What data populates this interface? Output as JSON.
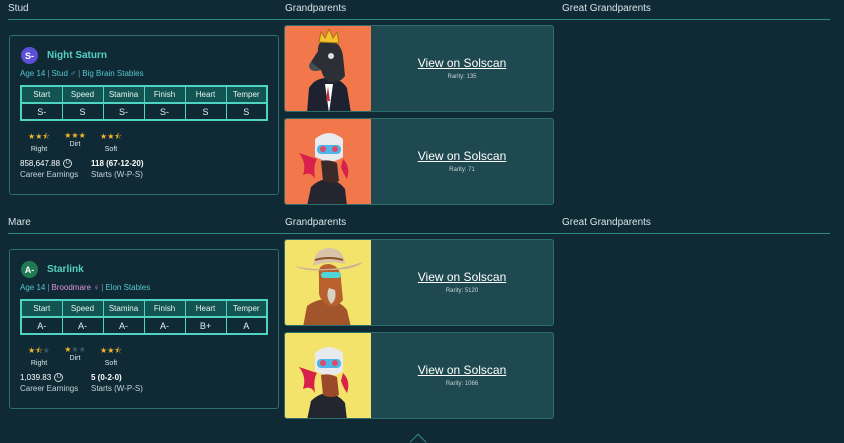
{
  "sections": {
    "stud": "Stud",
    "mare": "Mare",
    "grandparents": "Grandparents",
    "great_grandparents": "Great Grandparents"
  },
  "stud": {
    "name": "Night Saturn",
    "grade": "S-",
    "grade_color": "#5b4fd6",
    "age": "Age 14",
    "role": "Stud",
    "role_icon": "male-icon",
    "stable": "Big Brain Stables",
    "stats_headers": [
      "Start",
      "Speed",
      "Stamina",
      "Finish",
      "Heart",
      "Temper"
    ],
    "stats_values": [
      "S-",
      "S",
      "S-",
      "S-",
      "S",
      "S"
    ],
    "prefs": [
      {
        "label": "Right",
        "stars": 2.5
      },
      {
        "label": "Dirt",
        "stars": 3
      },
      {
        "label": "Soft",
        "stars": 2.5
      }
    ],
    "earnings": "858,647.88",
    "earnings_label": "Career Earnings",
    "starts": "118 (67-12-20)",
    "starts_label": "Starts (W-P-S)"
  },
  "mare": {
    "name": "Starlink",
    "grade": "A-",
    "grade_color": "#1f7a52",
    "age": "Age 14",
    "role": "Broodmare",
    "role_icon": "female-icon",
    "stable": "Elon Stables",
    "stats_headers": [
      "Start",
      "Speed",
      "Stamina",
      "Finish",
      "Heart",
      "Temper"
    ],
    "stats_values": [
      "A-",
      "A-",
      "A-",
      "A-",
      "B+",
      "A"
    ],
    "prefs": [
      {
        "label": "Right",
        "stars": 1.5
      },
      {
        "label": "Dirt",
        "stars": 1
      },
      {
        "label": "Soft",
        "stars": 2.5
      }
    ],
    "earnings": "1,039.83",
    "earnings_label": "Career Earnings",
    "starts": "5 (0-2-0)",
    "starts_label": "Starts (W-P-S)"
  },
  "grandparents": [
    {
      "link": "View on Solscan",
      "rarity": "Rarity: 135",
      "bg": "#f2784b"
    },
    {
      "link": "View on Solscan",
      "rarity": "Rarity: 71",
      "bg": "#f2784b"
    },
    {
      "link": "View on Solscan",
      "rarity": "Rarity: 5120",
      "bg": "#f3e36a"
    },
    {
      "link": "View on Solscan",
      "rarity": "Rarity: 1066",
      "bg": "#f3e36a"
    }
  ],
  "coin_symbol": "U"
}
